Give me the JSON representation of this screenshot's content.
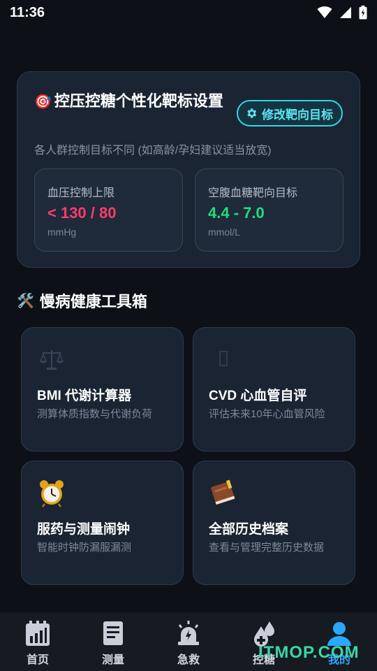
{
  "status_bar": {
    "time": "11:36"
  },
  "target_card": {
    "title_emoji": "🎯",
    "title": "控压控糖个性化靶标设置",
    "modify_button": "修改靶向目标",
    "subtitle": "各人群控制目标不同 (如高龄/孕妇建议适当放宽)",
    "bp": {
      "label": "血压控制上限",
      "value": "< 130 / 80",
      "unit": "mmHg",
      "color": "#ff3d6a"
    },
    "glucose": {
      "label": "空腹血糖靶向目标",
      "value": "4.4 - 7.0",
      "unit": "mmol/L",
      "color": "#1fe07a"
    }
  },
  "toolbox": {
    "title_icon": "🛠️",
    "title": "慢病健康工具箱",
    "tools": [
      {
        "icon": "scales-icon",
        "title": "BMI 代谢计算器",
        "desc": "测算体质指数与代谢负荷"
      },
      {
        "icon": "heart-icon",
        "title": "CVD 心血管自评",
        "desc": "评估未来10年心血管风险"
      },
      {
        "icon": "alarm-clock-icon",
        "title": "服药与测量闹钟",
        "desc": "智能时钟防漏服漏测"
      },
      {
        "icon": "book-icon",
        "title": "全部历史档案",
        "desc": "查看与管理完整历史数据"
      }
    ]
  },
  "bottom_nav": [
    {
      "label": "首页",
      "icon": "home-chart-icon"
    },
    {
      "label": "测量",
      "icon": "clipboard-icon"
    },
    {
      "label": "急救",
      "icon": "siren-icon"
    },
    {
      "label": "控糖",
      "icon": "blood-drop-icon"
    },
    {
      "label": "我的",
      "icon": "user-icon",
      "active": true
    }
  ],
  "watermark": "ITMOP.COM"
}
